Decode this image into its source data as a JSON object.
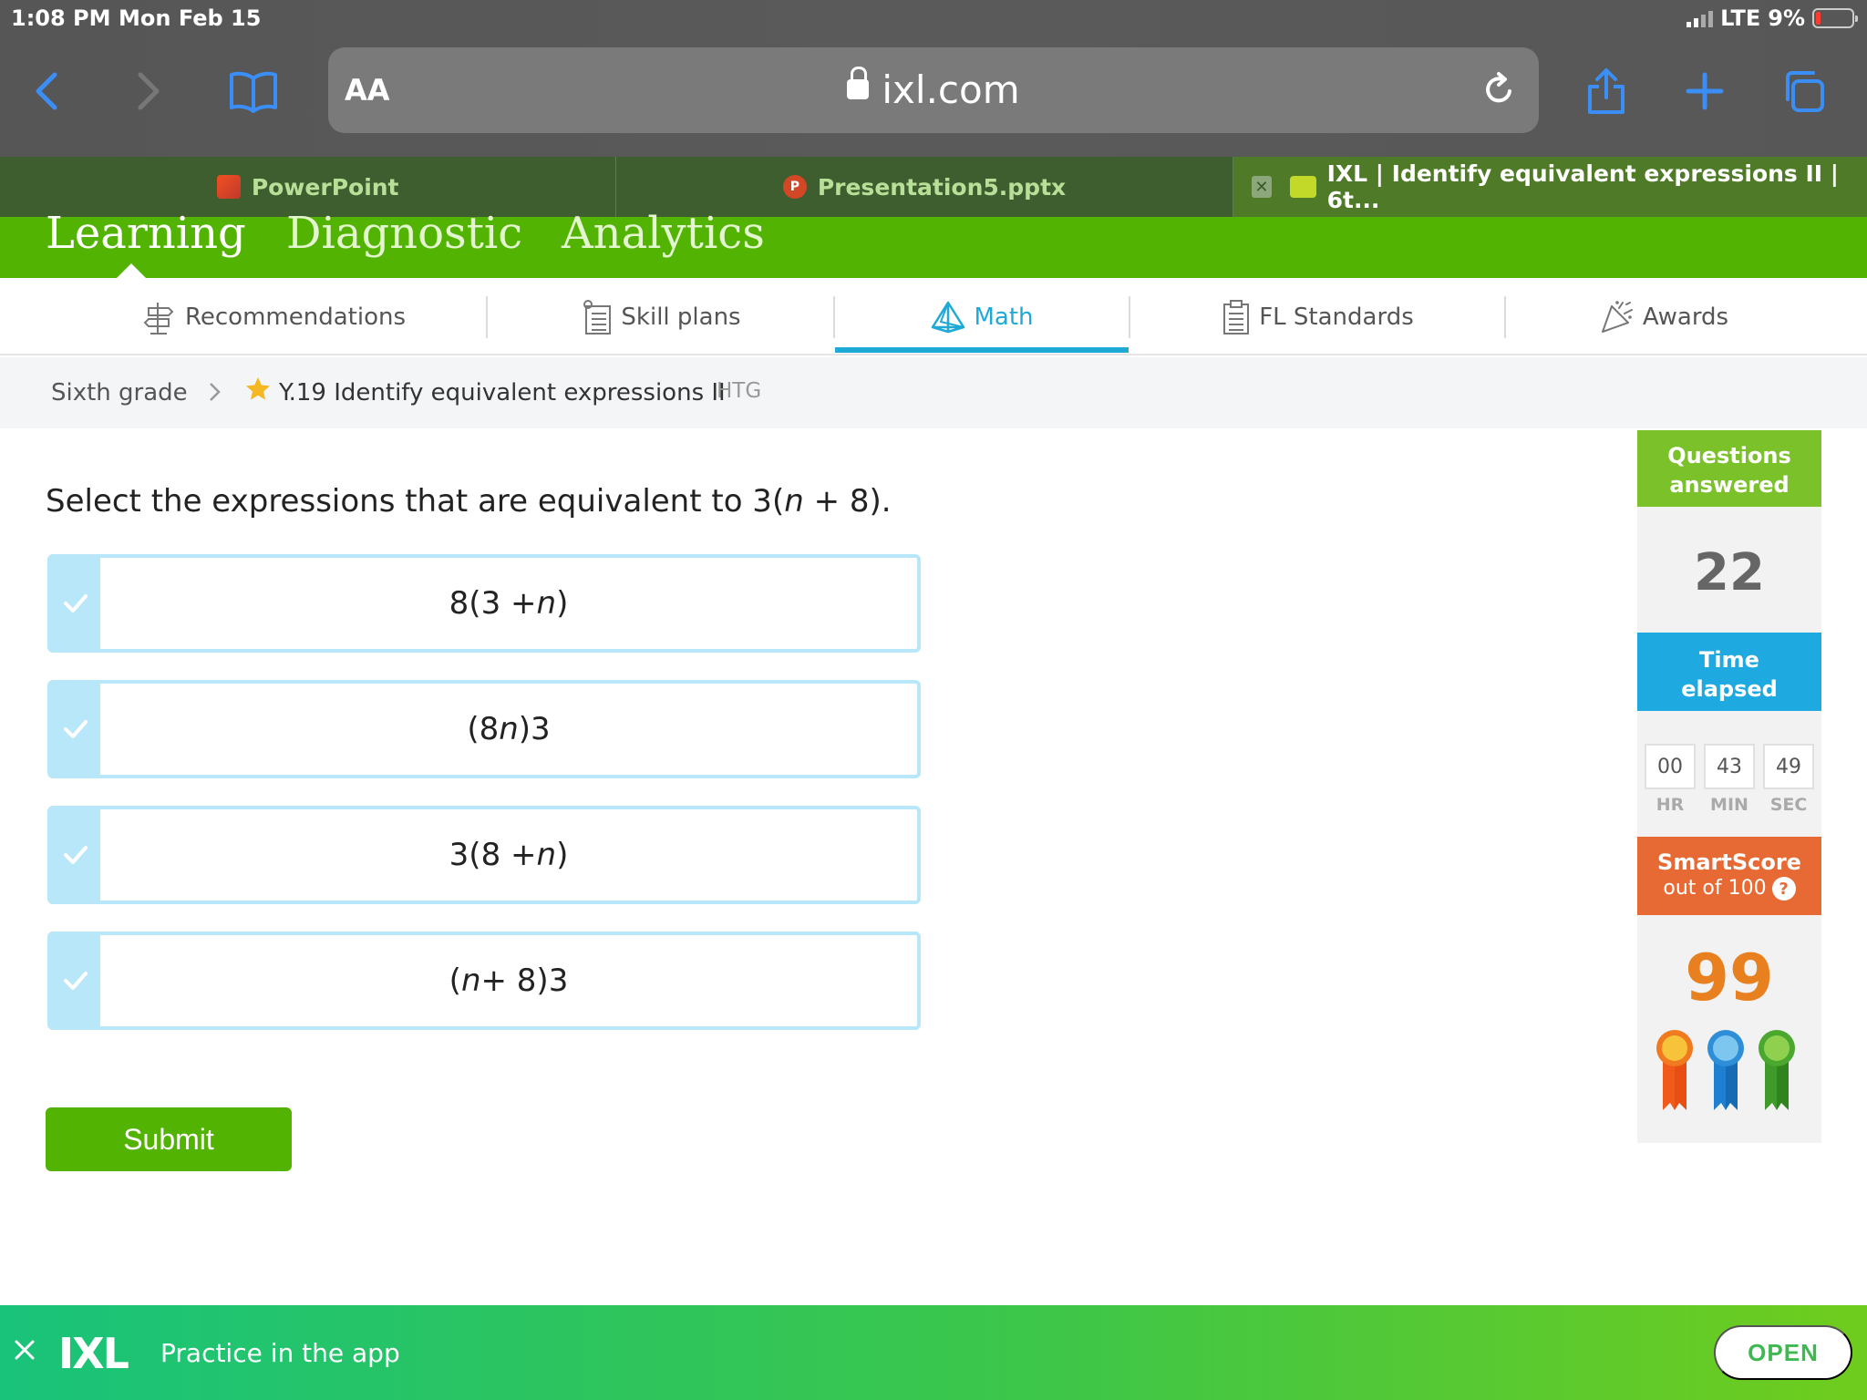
{
  "status": {
    "time": "1:08 PM",
    "date": "Mon Feb 15",
    "network": "LTE",
    "battery": "9%"
  },
  "browser": {
    "text_size_label": "AA",
    "url": "ixl.com",
    "tabs": [
      {
        "label": "PowerPoint"
      },
      {
        "label": "Presentation5.pptx"
      },
      {
        "label": "IXL | Identify equivalent expressions II | 6t..."
      }
    ]
  },
  "top_nav": {
    "items": [
      "Learning",
      "Diagnostic",
      "Analytics"
    ]
  },
  "sub_nav": {
    "items": [
      "Recommendations",
      "Skill plans",
      "Math",
      "FL Standards",
      "Awards"
    ]
  },
  "breadcrumb": {
    "grade": "Sixth grade",
    "skill": "Y.19 Identify equivalent expressions II",
    "code": "HTG"
  },
  "question": {
    "prompt_pre": "Select the expressions that are equivalent to 3(",
    "prompt_var": "n",
    "prompt_post": " + 8).",
    "choices": [
      {
        "parts": [
          "8(3 + ",
          "n",
          ")"
        ]
      },
      {
        "parts": [
          "(8",
          "n",
          ")3"
        ]
      },
      {
        "parts": [
          "3(8 + ",
          "n",
          ")"
        ]
      },
      {
        "parts": [
          "(",
          "n",
          " + 8)3"
        ]
      }
    ],
    "submit_label": "Submit"
  },
  "sidebar": {
    "questions_label_1": "Questions",
    "questions_label_2": "answered",
    "questions_count": "22",
    "time_label_1": "Time",
    "time_label_2": "elapsed",
    "timer": {
      "hr": "00",
      "min": "43",
      "sec": "49",
      "hr_label": "HR",
      "min_label": "MIN",
      "sec_label": "SEC"
    },
    "smartscore_label": "SmartScore",
    "smartscore_sub": "out of 100",
    "smartscore_help": "?",
    "smartscore": "99"
  },
  "banner": {
    "logo": "IXL",
    "text": "Practice in the app",
    "open_label": "OPEN"
  },
  "colors": {
    "ixl_green": "#52b303",
    "ixl_blue": "#1fa9d6",
    "smartscore_orange": "#e76a34",
    "score_orange": "#e8801f"
  }
}
